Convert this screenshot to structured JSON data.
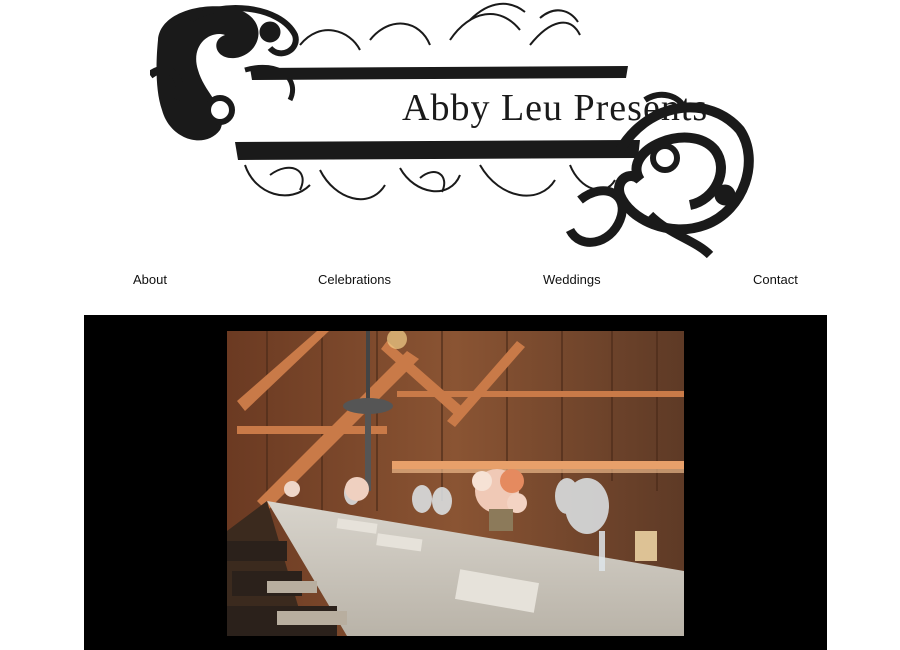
{
  "brand": {
    "title": "Abby Leu Presents"
  },
  "nav": {
    "items": [
      {
        "label": "About"
      },
      {
        "label": "Celebrations"
      },
      {
        "label": "Weddings"
      },
      {
        "label": "Contact"
      }
    ]
  },
  "colors": {
    "page_background": "#ffffff",
    "gallery_background": "#000000",
    "logo_ink": "#1a1a1a",
    "nav_text": "#111111"
  }
}
